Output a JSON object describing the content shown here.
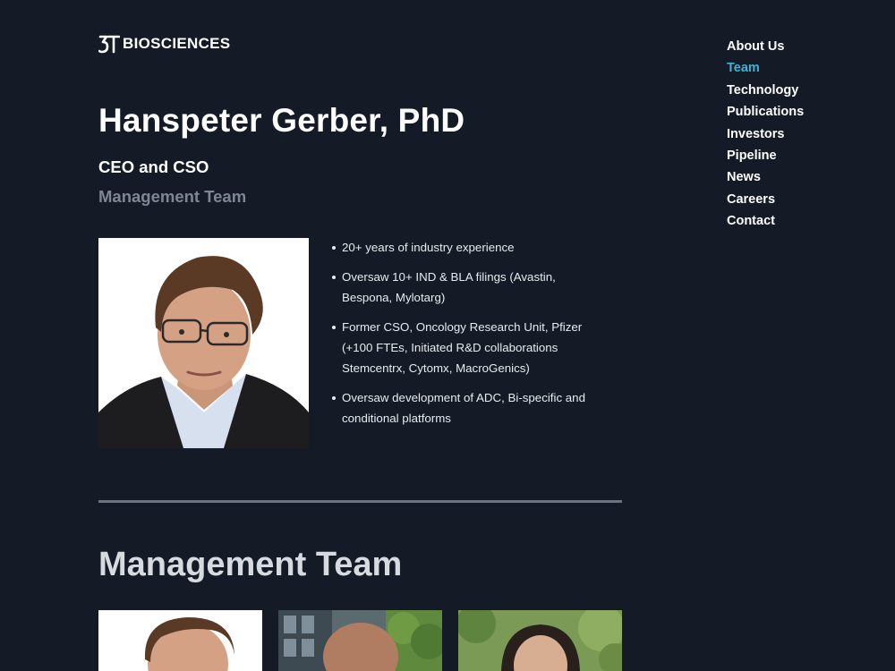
{
  "brand": {
    "logo_mark": "3T",
    "name": "BIOSCIENCES"
  },
  "nav": {
    "items": [
      {
        "label": "About Us",
        "active": false
      },
      {
        "label": "Team",
        "active": true
      },
      {
        "label": "Technology",
        "active": false
      },
      {
        "label": "Publications",
        "active": false
      },
      {
        "label": "Investors",
        "active": false
      },
      {
        "label": "Pipeline",
        "active": false
      },
      {
        "label": "News",
        "active": false
      },
      {
        "label": "Careers",
        "active": false
      },
      {
        "label": "Contact",
        "active": false
      }
    ],
    "active_color": "#3bb4d6"
  },
  "profile": {
    "name": "Hanspeter Gerber, PhD",
    "title": "CEO and CSO",
    "group": "Management Team",
    "bullets": [
      "20+ years of industry experience",
      "Oversaw 10+ IND & BLA filings (Avastin, Bespona, Mylotarg)",
      "Former CSO, Oncology Research Unit, Pfizer (+100 FTEs, Initiated R&D collaborations Stemcentrx, Cytomx, MacroGenics)",
      "Oversaw development of ADC, Bi-specific and conditional platforms"
    ]
  },
  "team_section": {
    "title": "Management Team",
    "cards": [
      {
        "photo": "portrait-photo-white-background"
      },
      {
        "photo": "portrait-photo-building-background"
      },
      {
        "photo": "portrait-photo-greenery-background"
      }
    ]
  },
  "colors": {
    "background": "#141b26",
    "muted_text": "#7d8794",
    "divider": "#6b7480"
  }
}
